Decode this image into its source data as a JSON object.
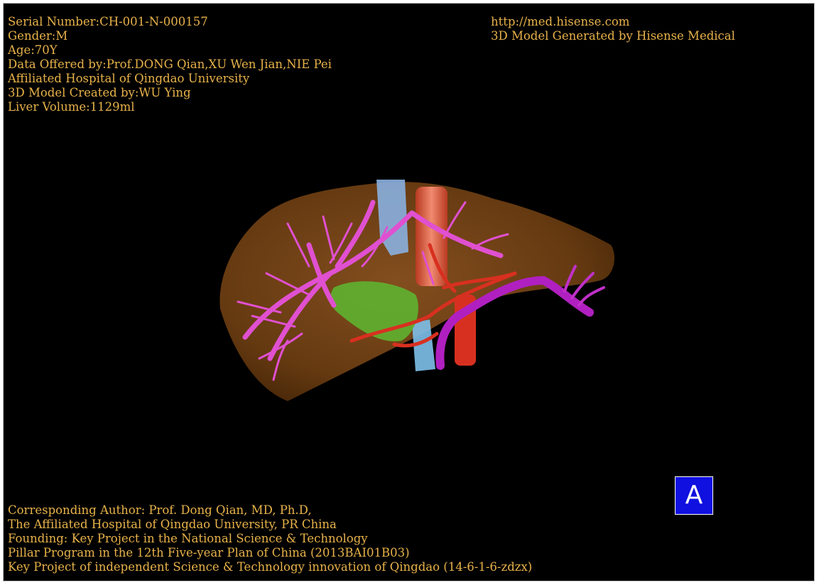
{
  "info": {
    "top_left": [
      "Serial Number:CH-001-N-000157",
      "Gender:M",
      "Age:70Y",
      "Data Offered by:Prof.DONG Qian,XU Wen Jian,NIE Pei",
      "Affiliated Hospital of Qingdao University",
      "3D Model Created by:WU Ying",
      "Liver Volume:1129ml"
    ],
    "top_right": [
      "http://med.hisense.com",
      "3D Model Generated by Hisense Medical"
    ],
    "bottom_left": [
      "Corresponding Author: Prof. Dong Qian, MD, Ph.D,",
      "The Affiliated Hospital of Qingdao University, PR China",
      "Founding: Key Project in the National Science & Technology",
      "Pillar Program in the 12th Five-year Plan of China (2013BAI01B03)",
      "Key Project of independent Science & Technology innovation of Qingdao (14-6-1-6-zdzx)"
    ]
  },
  "view_badge": "A",
  "colors": {
    "background": "#000000",
    "text": "#e8b24a",
    "liver": "#6b3d12",
    "hepatic_vein": "#e050d0",
    "portal_vein": "#b020c0",
    "artery": "#d83020",
    "vena_cava": "#8ab0e0",
    "gallbladder": "#60b030",
    "badge": "#1010e0"
  }
}
